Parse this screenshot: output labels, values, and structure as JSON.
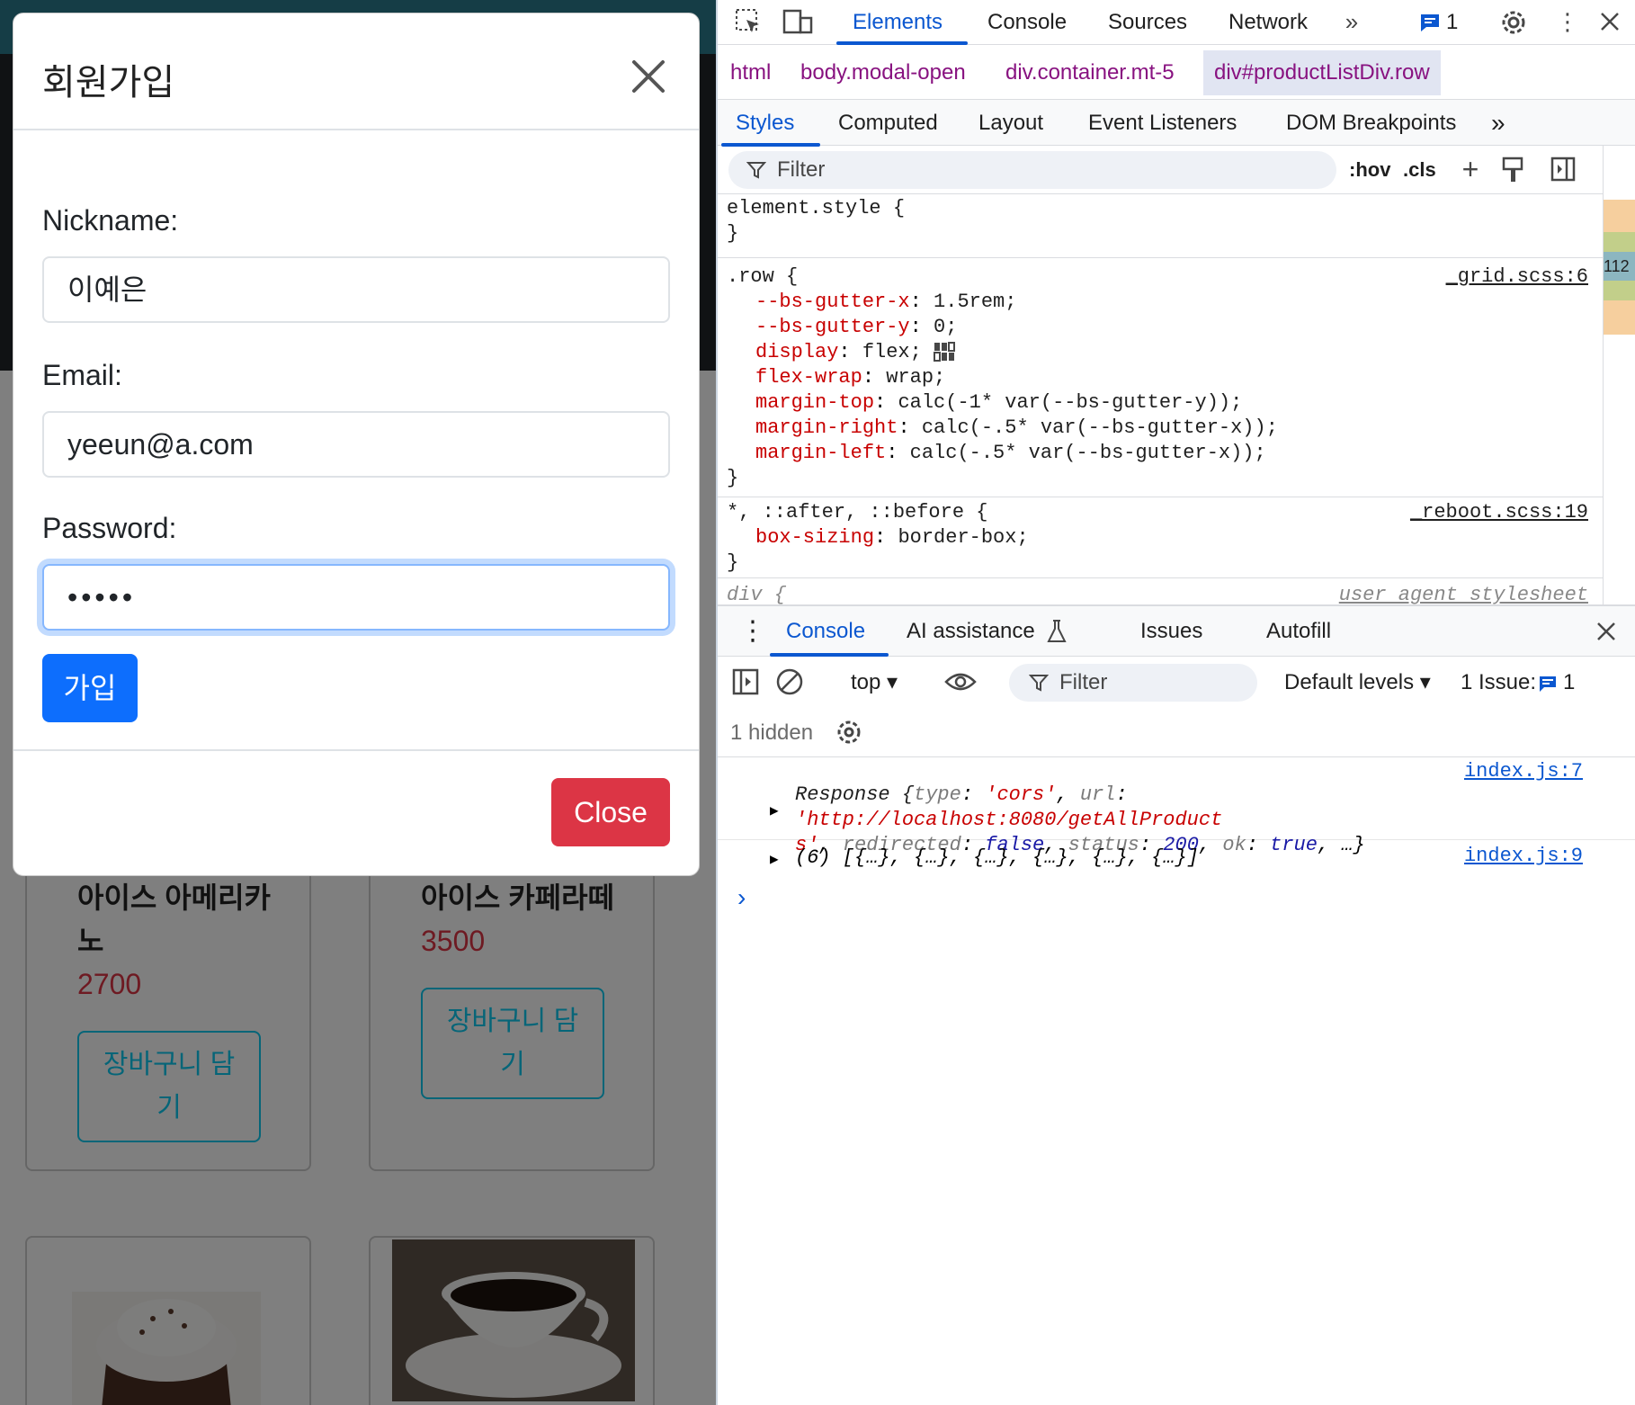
{
  "page": {
    "products": [
      {
        "name_line1": "아이스 아메리카",
        "name_line2": "노",
        "price": "2700",
        "cart_line1": "장바구니 담",
        "cart_line2": "기"
      },
      {
        "name_line1": "아이스 카페라떼",
        "name_line2": "",
        "price": "3500",
        "cart_line1": "장바구니 담",
        "cart_line2": "기"
      }
    ]
  },
  "modal": {
    "title": "회원가입",
    "nickname_label": "Nickname:",
    "nickname_value": "이예은",
    "email_label": "Email:",
    "email_value": "yeeun@a.com",
    "password_label": "Password:",
    "password_value": "•••••",
    "join_label": "가입",
    "close_label": "Close"
  },
  "devtools": {
    "tabs": [
      "Elements",
      "Console",
      "Sources",
      "Network"
    ],
    "issues_count": "1",
    "breadcrumb": [
      "html",
      "body.modal-open",
      "div.container.mt-5",
      "div#productListDiv.row"
    ],
    "styles_tabs": [
      "Styles",
      "Computed",
      "Layout",
      "Event Listeners",
      "DOM Breakpoints"
    ],
    "filter_placeholder": "Filter",
    "hov": ":hov",
    "cls": ".cls",
    "element_style": "element.style {",
    "close_brace": "}",
    "row_selector": ".row {",
    "row_source": "_grid.scss:6",
    "row_props": [
      {
        "p": "--bs-gutter-x",
        "v": "1.5rem;"
      },
      {
        "p": "--bs-gutter-y",
        "v": "0;"
      },
      {
        "p": "display",
        "v": "flex;"
      },
      {
        "p": "flex-wrap",
        "v": "wrap;"
      },
      {
        "p": "margin-top",
        "v": "calc(-1* var(--bs-gutter-y));"
      },
      {
        "p": "margin-right",
        "v": "calc(-.5* var(--bs-gutter-x));"
      },
      {
        "p": "margin-left",
        "v": "calc(-.5* var(--bs-gutter-x));"
      }
    ],
    "universal_selector": "*, ::after, ::before {",
    "universal_source": "_reboot.scss:19",
    "box_sizing_prop": "box-sizing",
    "box_sizing_val": "border-box;",
    "div_selector": "div {",
    "div_source": "user agent stylesheet",
    "box_model_number": "112",
    "drawer_tabs": [
      "Console",
      "AI assistance",
      "Issues",
      "Autofill"
    ],
    "context": "top",
    "console_filter": "Filter",
    "levels": "Default levels",
    "issue_label": "1 Issue:",
    "issue_count": "1",
    "hidden": "1 hidden",
    "log1_source": "index.js:7",
    "log2_source": "index.js:9",
    "log2_text": "(6) [{…}, {…}, {…}, {…}, {…}, {…}]",
    "prompt": "›"
  }
}
